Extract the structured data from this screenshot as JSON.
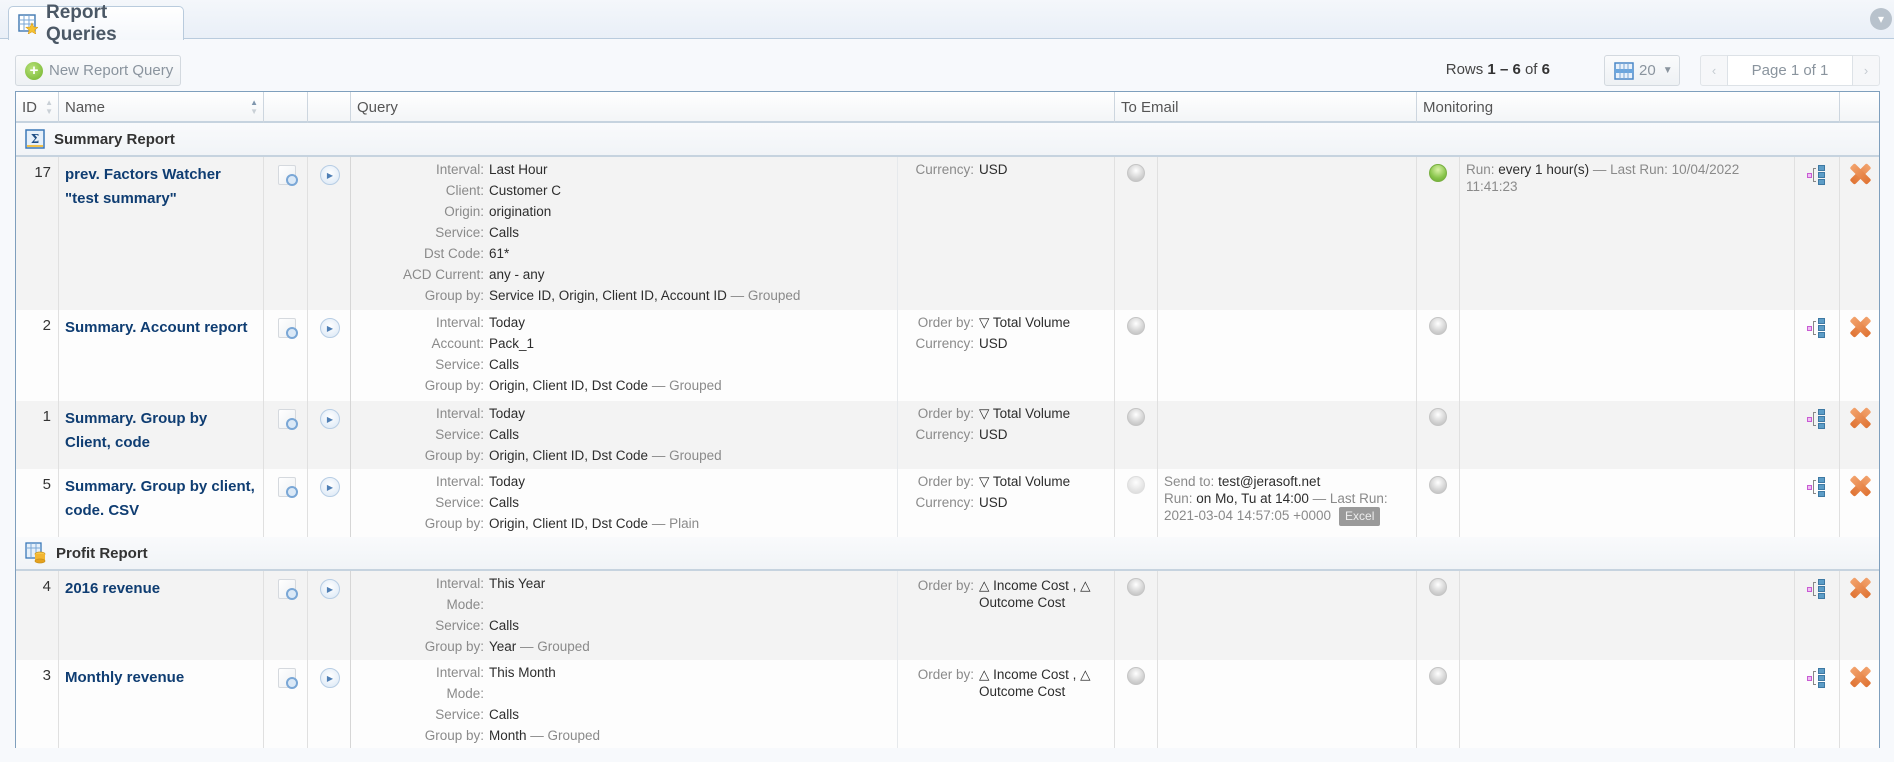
{
  "tab": {
    "title": "Report Queries",
    "icon": "report-queries-icon"
  },
  "toolbar": {
    "new_button": "New Report Query",
    "rows_prefix": "Rows",
    "rows_from": "1",
    "rows_sep": "–",
    "rows_to": "6",
    "rows_of": "of",
    "rows_total": "6",
    "per_page": "20",
    "page_label": "Page 1 of 1",
    "prev": "‹",
    "next": "›"
  },
  "columns": {
    "id": "ID",
    "name": "Name",
    "query": "Query",
    "to_email": "To Email",
    "monitoring": "Monitoring"
  },
  "groups": [
    {
      "name": "Summary Report",
      "rows": [
        {
          "id": "17",
          "name": "prev. Factors Watcher \"test summary\"",
          "query_left": [
            {
              "k": "Interval:",
              "v": "Last Hour"
            },
            {
              "k": "Client:",
              "v": "Customer C"
            },
            {
              "k": "Origin:",
              "v": "origination"
            },
            {
              "k": "Service:",
              "v": "Calls"
            },
            {
              "k": "Dst Code:",
              "v": "61*"
            },
            {
              "k": "ACD Current:",
              "v": "any - any"
            },
            {
              "k": "Group by:",
              "v": "Service ID, Origin, Client ID, Account ID",
              "muted": " — Grouped"
            }
          ],
          "query_right": [
            {
              "k": "Currency:",
              "v": "USD"
            }
          ],
          "email_status": "off",
          "monitoring_status": "on",
          "monitoring": {
            "run_label": "Run:",
            "run_value": "every 1 hour(s)",
            "last_label": " — Last Run: 10/04/2022 11:41:23"
          }
        },
        {
          "id": "2",
          "name": "Summary. Account report",
          "query_left": [
            {
              "k": "Interval:",
              "v": "Today"
            },
            {
              "k": "Account:",
              "v": "Pack_1"
            },
            {
              "k": "Service:",
              "v": "Calls"
            },
            {
              "k": "Group by:",
              "v": "Origin, Client ID, Dst Code",
              "muted": " — Grouped"
            }
          ],
          "query_right": [
            {
              "k": "Order by:",
              "v": "▽ Total Volume"
            },
            {
              "k": "Currency:",
              "v": "USD"
            }
          ],
          "email_status": "off",
          "monitoring_status": "off"
        },
        {
          "id": "1",
          "name": "Summary. Group by Client, code",
          "query_left": [
            {
              "k": "Interval:",
              "v": "Today"
            },
            {
              "k": "Service:",
              "v": "Calls"
            },
            {
              "k": "Group by:",
              "v": "Origin, Client ID, Dst Code",
              "muted": " — Grouped"
            }
          ],
          "query_right": [
            {
              "k": "Order by:",
              "v": "▽ Total Volume"
            },
            {
              "k": "Currency:",
              "v": "USD"
            }
          ],
          "email_status": "off",
          "monitoring_status": "off"
        },
        {
          "id": "5",
          "name": "Summary. Group by client, code. CSV",
          "query_left": [
            {
              "k": "Interval:",
              "v": "Today"
            },
            {
              "k": "Service:",
              "v": "Calls"
            },
            {
              "k": "Group by:",
              "v": "Origin, Client ID, Dst Code",
              "muted": " — Plain"
            }
          ],
          "query_right": [
            {
              "k": "Order by:",
              "v": "▽ Total Volume"
            },
            {
              "k": "Currency:",
              "v": "USD"
            }
          ],
          "email_status": "faint",
          "monitoring_status": "off",
          "email": {
            "send_label": "Send to:",
            "send_value": "test@jerasoft.net",
            "run_label": "Run:",
            "run_value": "on Mo, Tu at 14:00",
            "last_label": " — Last Run: 2021-03-04 14:57:05 +0000",
            "format_badge": "Excel"
          }
        }
      ]
    },
    {
      "name": "Profit Report",
      "rows": [
        {
          "id": "4",
          "name": "2016 revenue",
          "query_left": [
            {
              "k": "Interval:",
              "v": "This Year"
            },
            {
              "k": "Mode:",
              "v": ""
            },
            {
              "k": "Service:",
              "v": "Calls"
            },
            {
              "k": "Group by:",
              "v": "Year",
              "muted": " — Grouped"
            }
          ],
          "order_multi": {
            "k": "Order by:",
            "v": "△ Income Cost , △ Outcome Cost"
          },
          "email_status": "off",
          "monitoring_status": "off"
        },
        {
          "id": "3",
          "name": "Monthly revenue",
          "query_left": [
            {
              "k": "Interval:",
              "v": "This Month"
            },
            {
              "k": "Mode:",
              "v": ""
            },
            {
              "k": "Service:",
              "v": "Calls"
            },
            {
              "k": "Group by:",
              "v": "Month",
              "muted": " — Grouped"
            }
          ],
          "order_multi": {
            "k": "Order by:",
            "v": "△ Income Cost , △ Outcome Cost"
          },
          "email_status": "off",
          "monitoring_status": "off"
        }
      ]
    }
  ]
}
